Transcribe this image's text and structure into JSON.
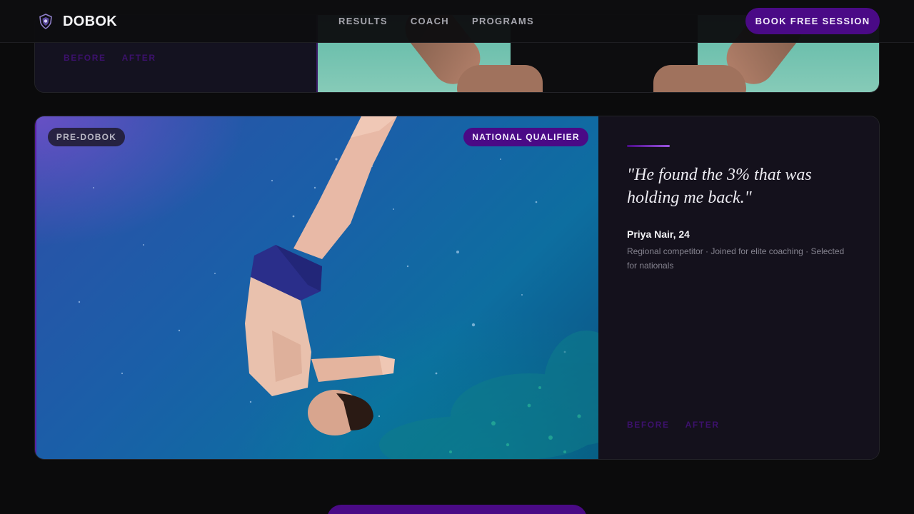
{
  "header": {
    "brand": "DOBOK",
    "nav": [
      "RESULTS",
      "COACH",
      "PROGRAMS"
    ],
    "cta": "BOOK FREE SESSION"
  },
  "previous_card": {
    "toggle": [
      "BEFORE",
      "AFTER"
    ]
  },
  "testimonial": {
    "badge_left": "PRE-DOBOK",
    "badge_right": "NATIONAL QUALIFIER",
    "quote": "\"He found the 3% that was holding me back.\"",
    "name": "Priya Nair, 24",
    "description": "Regional competitor · Joined for elite coaching · Selected for nationals",
    "toggle": [
      "BEFORE",
      "AFTER"
    ]
  },
  "colors": {
    "accent": "#4a0a86",
    "background": "#0b0b0c",
    "card": "#13111b"
  }
}
